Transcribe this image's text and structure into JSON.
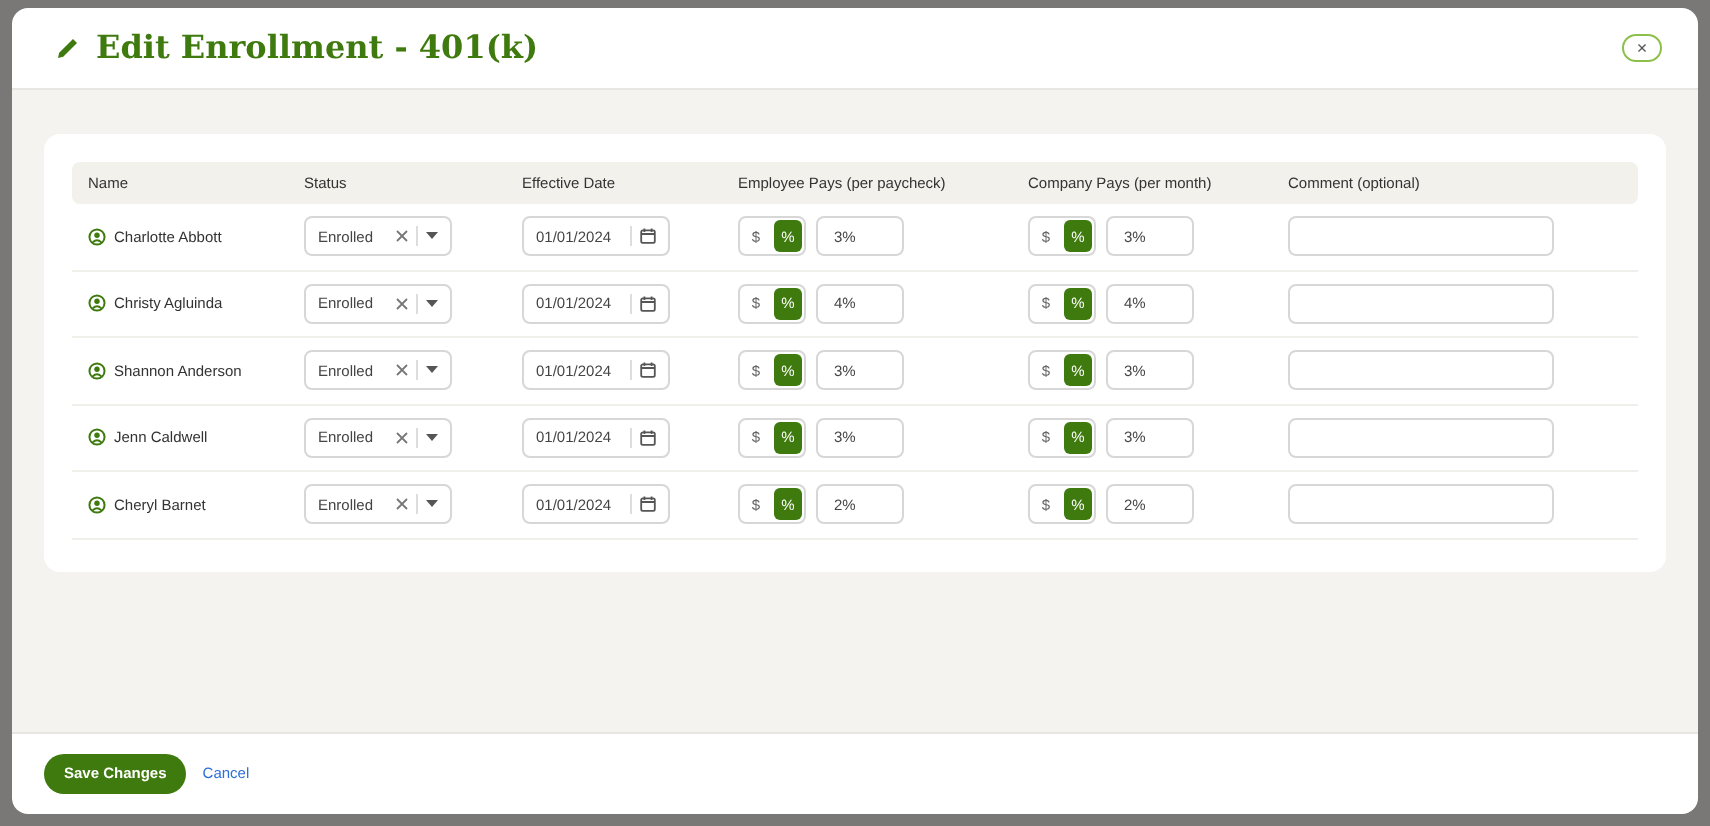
{
  "modal": {
    "title": "Edit Enrollment - 401(k)",
    "close_label": "×"
  },
  "table": {
    "columns": [
      "Name",
      "Status",
      "Effective Date",
      "Employee Pays (per paycheck)",
      "Company Pays (per month)",
      "Comment (optional)"
    ],
    "rows": [
      {
        "name": "Charlotte Abbott",
        "status": "Enrolled",
        "date": "01/01/2024",
        "employee": {
          "units": [
            {
              "label": "$",
              "selected": false
            },
            {
              "label": "%",
              "selected": true
            }
          ],
          "value": "3%"
        },
        "company": {
          "units": [
            {
              "label": "$",
              "selected": false
            },
            {
              "label": "%",
              "selected": true
            }
          ],
          "value": "3%"
        }
      },
      {
        "name": "Christy Agluinda",
        "status": "Enrolled",
        "date": "01/01/2024",
        "employee": {
          "units": [
            {
              "label": "$",
              "selected": false
            },
            {
              "label": "%",
              "selected": true
            }
          ],
          "value": "4%"
        },
        "company": {
          "units": [
            {
              "label": "$",
              "selected": false
            },
            {
              "label": "%",
              "selected": true
            }
          ],
          "value": "4%"
        }
      },
      {
        "name": "Shannon Anderson",
        "status": "Enrolled",
        "date": "01/01/2024",
        "employee": {
          "units": [
            {
              "label": "$",
              "selected": false
            },
            {
              "label": "%",
              "selected": true
            }
          ],
          "value": "3%"
        },
        "company": {
          "units": [
            {
              "label": "$",
              "selected": false
            },
            {
              "label": "%",
              "selected": true
            }
          ],
          "value": "3%"
        }
      },
      {
        "name": "Jenn Caldwell",
        "status": "Enrolled",
        "date": "01/01/2024",
        "employee": {
          "units": [
            {
              "label": "$",
              "selected": false
            },
            {
              "label": "%",
              "selected": true
            }
          ],
          "value": "3%"
        },
        "company": {
          "units": [
            {
              "label": "$",
              "selected": false
            },
            {
              "label": "%",
              "selected": true
            }
          ],
          "value": "3%"
        }
      },
      {
        "name": "Cheryl Barnet",
        "status": "Enrolled",
        "date": "01/01/2024",
        "employee": {
          "units": [
            {
              "label": "$",
              "selected": false
            },
            {
              "label": "%",
              "selected": true
            }
          ],
          "value": "2%"
        },
        "company": {
          "units": [
            {
              "label": "$",
              "selected": false
            },
            {
              "label": "%",
              "selected": true
            }
          ],
          "value": "2%"
        }
      }
    ]
  },
  "footer": {
    "buttons": [
      {
        "label": "Save Changes",
        "kind": "primary"
      },
      {
        "label": "Cancel",
        "kind": "link"
      }
    ]
  }
}
